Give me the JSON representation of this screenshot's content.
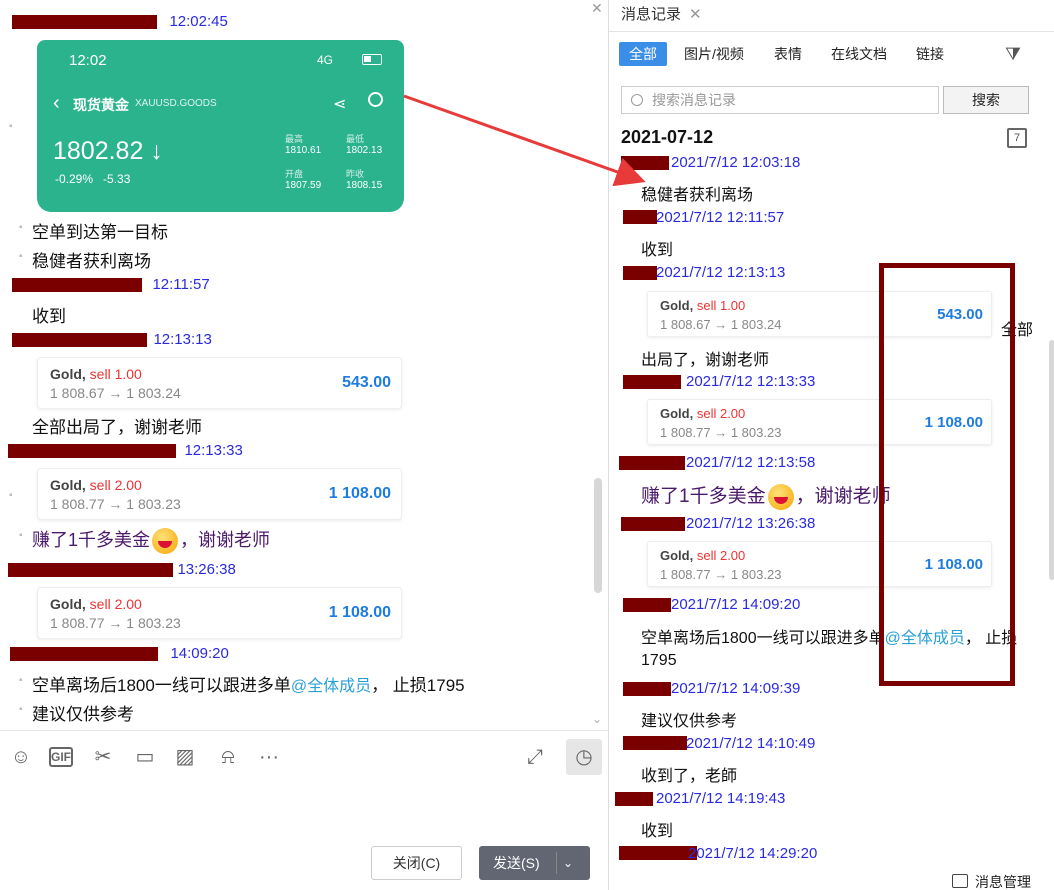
{
  "left": {
    "top_time": "12:02:45",
    "phone": {
      "clock": "12:02",
      "network": "4G",
      "name": "现货黄金",
      "code": "XAUUSD.GOODS",
      "price": "1802.82",
      "change_pct": "-0.29%",
      "change_abs": "-5.33",
      "high_label": "最高",
      "high": "1810.61",
      "low_label": "最低",
      "low": "1802.13",
      "open_label": "开盘",
      "open": "1807.59",
      "prev_label": "昨收",
      "prev": "1808.15"
    },
    "messages": [
      {
        "id": "m1",
        "text": "空单到达第一目标"
      },
      {
        "id": "m2",
        "text": "稳健者获利离场"
      },
      {
        "id": "m3",
        "time": "12:11:57"
      },
      {
        "id": "m4",
        "text": "收到"
      },
      {
        "id": "m5",
        "time": "12:13:13"
      },
      {
        "id": "m6",
        "text": "全部出局了，谢谢老师"
      },
      {
        "id": "m7",
        "time": "12:13:33"
      },
      {
        "id": "m8",
        "text_a": "赚了1千多美金",
        "text_b": "，谢谢老师"
      },
      {
        "id": "m9",
        "time": "13:26:38"
      },
      {
        "id": "m10",
        "time": "14:09:20"
      },
      {
        "id": "m11",
        "text": "空单离场后1800一线可以跟进多单",
        "mention": "@全体成员",
        "tail": "， 止损1795"
      },
      {
        "id": "m12",
        "text": "建议仅供参考"
      }
    ],
    "cards": [
      {
        "asset": "Gold,",
        "side": "sell 1.00",
        "range": "1 808.67 → 1 803.24",
        "amount": "543.00"
      },
      {
        "asset": "Gold,",
        "side": "sell 2.00",
        "range": "1 808.77 → 1 803.23",
        "amount": "1 108.00"
      },
      {
        "asset": "Gold,",
        "side": "sell 2.00",
        "range": "1 808.77 → 1 803.23",
        "amount": "1 108.00"
      }
    ],
    "close_label": "关闭(C)",
    "send_label": "发送(S)"
  },
  "right": {
    "tab_title": "消息记录",
    "filters": [
      "全部",
      "图片/视频",
      "表情",
      "在线文档",
      "链接"
    ],
    "search_placeholder": "搜索消息记录",
    "search_button": "搜索",
    "date": "2021-07-12",
    "calendar_num": "7",
    "entries": [
      {
        "time": "2021/7/12 12:03:18",
        "text": "稳健者获利离场"
      },
      {
        "time": "2021/7/12 12:11:57",
        "text": "收到"
      },
      {
        "time": "2021/7/12 12:13:13",
        "text": "出局了，谢谢老师"
      },
      {
        "time": "2021/7/12 12:13:33"
      },
      {
        "time": "2021/7/12 12:13:58",
        "text_a": "赚了1千多美金",
        "text_b": "，谢谢老师"
      },
      {
        "time": "2021/7/12 13:26:38"
      },
      {
        "time": "2021/7/12 14:09:20",
        "text": "空单离场后1800一线可以跟进多单",
        "mention": "@全体成员",
        "tail": "， 止损",
        "line2": "1795"
      },
      {
        "time": "2021/7/12 14:09:39",
        "text": "建议仅供参考"
      },
      {
        "time": "2021/7/12 14:10:49",
        "text": "收到了，老師"
      },
      {
        "time": "2021/7/12 14:19:43",
        "text": "收到"
      },
      {
        "time": "2021/7/12 14:29:20"
      }
    ],
    "cards": [
      {
        "asset": "Gold,",
        "side": "sell 1.00",
        "range": "1 808.67 → 1 803.24",
        "amount": "543.00"
      },
      {
        "asset": "Gold,",
        "side": "sell 2.00",
        "range": "1 808.77 → 1 803.23",
        "amount": "1 108.00"
      },
      {
        "asset": "Gold,",
        "side": "sell 2.00",
        "range": "1 808.77 → 1 803.23",
        "amount": "1 108.00"
      }
    ],
    "overflow_text": "全部",
    "manage_label": "消息管理"
  }
}
